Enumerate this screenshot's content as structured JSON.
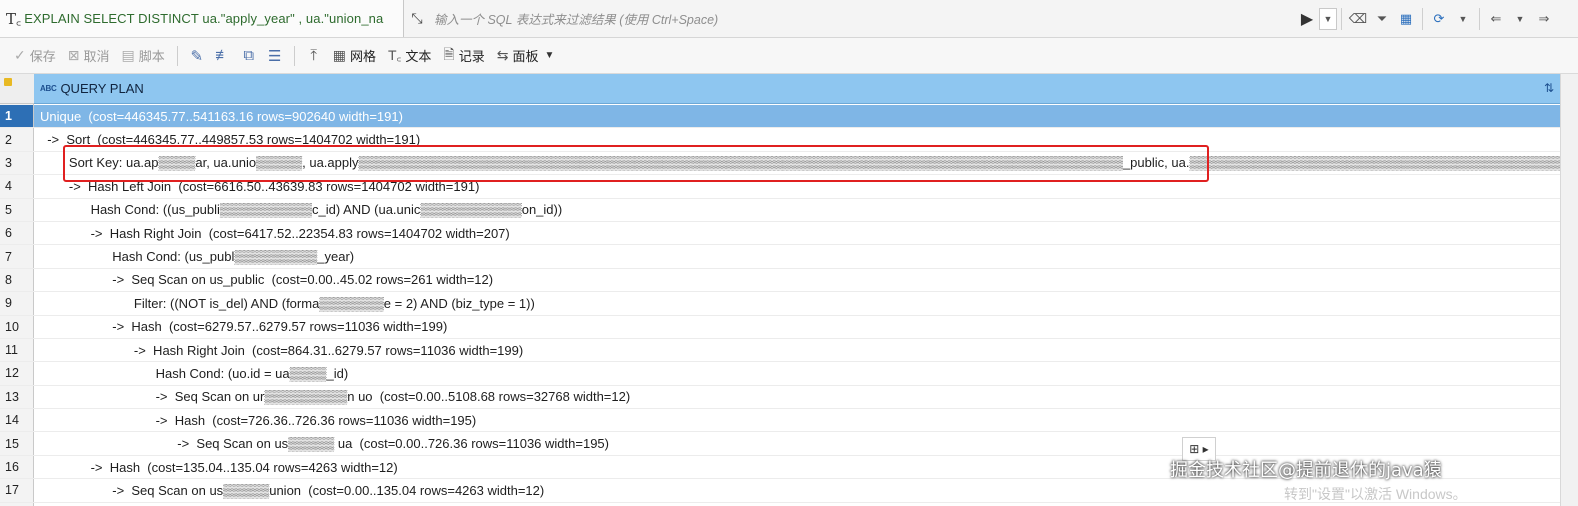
{
  "filter_bar": {
    "query_text": "EXPLAIN SELECT DISTINCT ua.\"apply_year\" , ua.\"union_na",
    "placeholder": "输入一个 SQL 表达式来过滤结果 (使用 Ctrl+Space)"
  },
  "toolbar": {
    "save_label": "保存",
    "cancel_label": "取消",
    "script_label": "脚本",
    "grid_label": "网格",
    "text_label": "文本",
    "record_label": "记录",
    "panel_label": "面板"
  },
  "grid": {
    "column_header": "QUERY PLAN",
    "column_type_badge": "ABC",
    "rows": [
      {
        "num": "1",
        "text": "Unique  (cost=446345.77..541163.16 rows=902640 width=191)"
      },
      {
        "num": "2",
        "text": "  ->  Sort  (cost=446345.77..449857.53 rows=1404702 width=191)"
      },
      {
        "num": "3",
        "text": "        Sort Key: ua.ap▒▒▒▒ar, ua.unio▒▒▒▒▒, ua.apply▒▒▒▒▒▒▒▒▒▒▒▒▒▒▒▒▒▒▒▒▒▒▒▒▒▒▒▒▒▒▒▒▒▒▒▒▒▒▒▒▒▒▒▒▒▒▒▒▒▒▒▒▒▒▒▒▒▒▒▒▒▒▒▒▒▒▒▒▒▒▒▒▒▒▒▒▒▒▒▒▒▒▒_public, ua.▒▒▒▒▒▒▒▒▒▒▒▒▒▒▒▒▒▒▒▒▒▒▒▒▒▒▒▒▒▒▒▒▒▒▒▒▒▒▒▒▒▒▒▒▒▒▒▒▒▒▒▒▒▒▒▒▒▒▒▒▒▒▒▒▒▒▒▒▒▒atus"
      },
      {
        "num": "4",
        "text": "        ->  Hash Left Join  (cost=6616.50..43639.83 rows=1404702 width=191)"
      },
      {
        "num": "5",
        "text": "              Hash Cond: ((us_publi▒▒▒▒▒▒▒▒▒▒c_id) AND (ua.unic▒▒▒▒▒▒▒▒▒▒▒on_id))"
      },
      {
        "num": "6",
        "text": "              ->  Hash Right Join  (cost=6417.52..22354.83 rows=1404702 width=207)"
      },
      {
        "num": "7",
        "text": "                    Hash Cond: (us_publ▒▒▒▒▒▒▒▒▒_year)"
      },
      {
        "num": "8",
        "text": "                    ->  Seq Scan on us_public  (cost=0.00..45.02 rows=261 width=12)"
      },
      {
        "num": "9",
        "text": "                          Filter: ((NOT is_del) AND (forma▒▒▒▒▒▒▒e = 2) AND (biz_type = 1))"
      },
      {
        "num": "10",
        "text": "                    ->  Hash  (cost=6279.57..6279.57 rows=11036 width=199)"
      },
      {
        "num": "11",
        "text": "                          ->  Hash Right Join  (cost=864.31..6279.57 rows=11036 width=199)"
      },
      {
        "num": "12",
        "text": "                                Hash Cond: (uo.id = ua▒▒▒▒_id)"
      },
      {
        "num": "13",
        "text": "                                ->  Seq Scan on ur▒▒▒▒▒▒▒▒▒n uo  (cost=0.00..5108.68 rows=32768 width=12)"
      },
      {
        "num": "14",
        "text": "                                ->  Hash  (cost=726.36..726.36 rows=11036 width=195)"
      },
      {
        "num": "15",
        "text": "                                      ->  Seq Scan on us▒▒▒▒▒ ua  (cost=0.00..726.36 rows=11036 width=195)"
      },
      {
        "num": "16",
        "text": "              ->  Hash  (cost=135.04..135.04 rows=4263 width=12)"
      },
      {
        "num": "17",
        "text": "                    ->  Seq Scan on us▒▒▒▒▒union  (cost=0.00..135.04 rows=4263 width=12)"
      }
    ]
  },
  "watermark": "掘金技术社区@提前退休的java猿",
  "windows_note": "转到\"设置\"以激活 Windows。",
  "colors": {
    "header_bg": "#8ec6f0",
    "selected_row_bg": "#7fb6e6",
    "highlight_box": "#e02020",
    "query_text": "#2e6b2e"
  }
}
